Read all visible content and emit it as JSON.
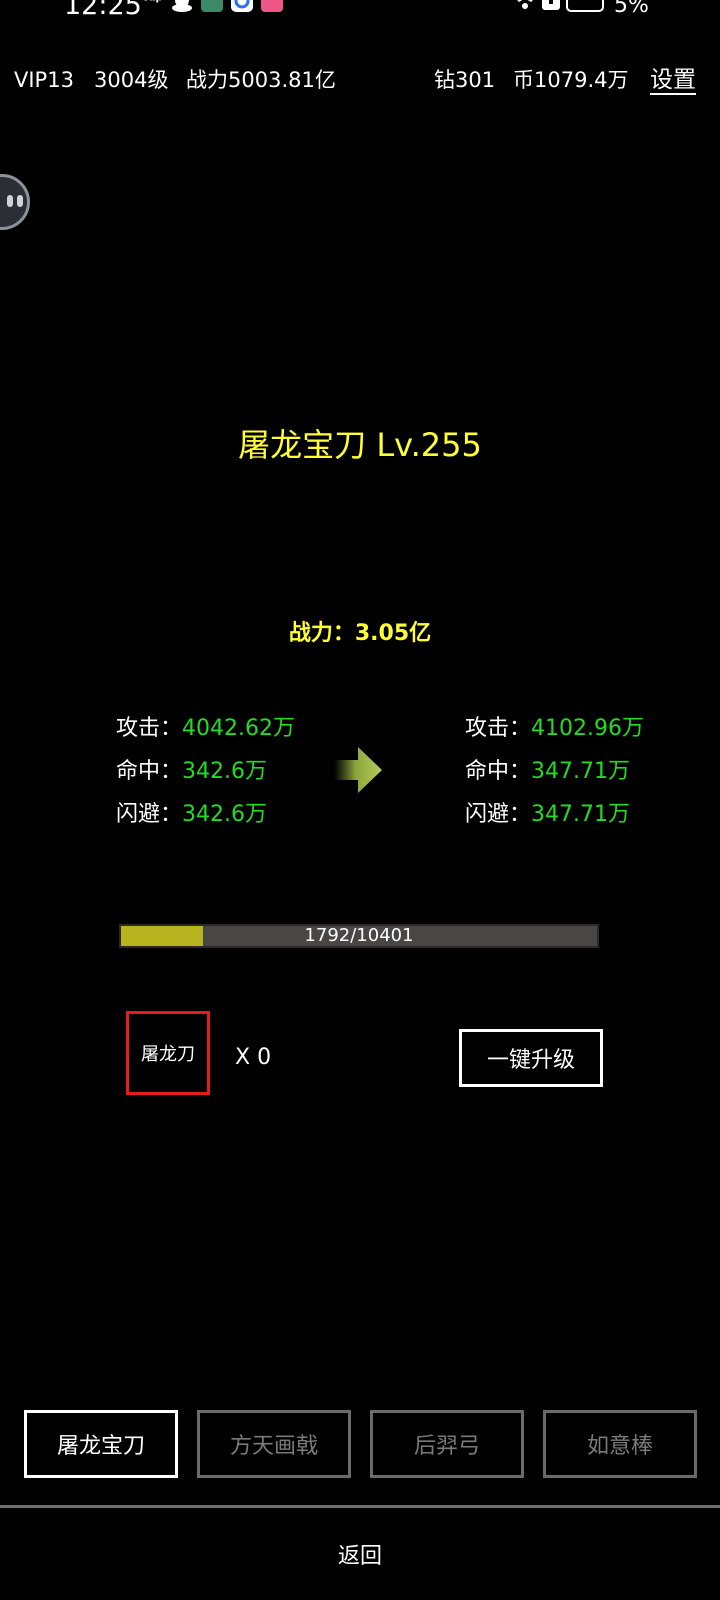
{
  "status_bar": {
    "time": "12:25",
    "battery_percent": "5%",
    "icons": [
      "tap-notification-icon",
      "qq-penguin-icon",
      "game-avatar-icon",
      "blue-app-icon",
      "pink-app-icon",
      "wifi-icon",
      "sim-icon",
      "battery-icon"
    ]
  },
  "header": {
    "vip": "VIP13",
    "level": "3004级",
    "power": "战力5003.81亿",
    "diamonds": "钻301",
    "coins": "币1079.4万",
    "settings_label": "设置"
  },
  "weapon": {
    "title": "屠龙宝刀 Lv.255",
    "power": "战力：3.05亿"
  },
  "stats": {
    "current": [
      {
        "label": "攻击：",
        "value": "4042.62万"
      },
      {
        "label": "命中：",
        "value": "342.6万"
      },
      {
        "label": "闪避：",
        "value": "342.6万"
      }
    ],
    "next": [
      {
        "label": "攻击：",
        "value": "4102.96万"
      },
      {
        "label": "命中：",
        "value": "347.71万"
      },
      {
        "label": "闪避：",
        "value": "347.71万"
      }
    ]
  },
  "progress": {
    "current": 1792,
    "total": 10401,
    "text": "1792/10401"
  },
  "material": {
    "name": "屠龙刀",
    "count": "X 0"
  },
  "upgrade_button_label": "一键升级",
  "tabs": [
    {
      "label": "屠龙宝刀",
      "active": true
    },
    {
      "label": "方天画戟",
      "active": false
    },
    {
      "label": "后羿弓",
      "active": false
    },
    {
      "label": "如意棒",
      "active": false
    }
  ],
  "back_label": "返回",
  "colors": {
    "background": "#000000",
    "title_yellow": "#ffff33",
    "stat_green": "#22dd22",
    "progress_fill": "#b8b420",
    "progress_track": "#4a4646",
    "material_border": "#e21d1d"
  }
}
